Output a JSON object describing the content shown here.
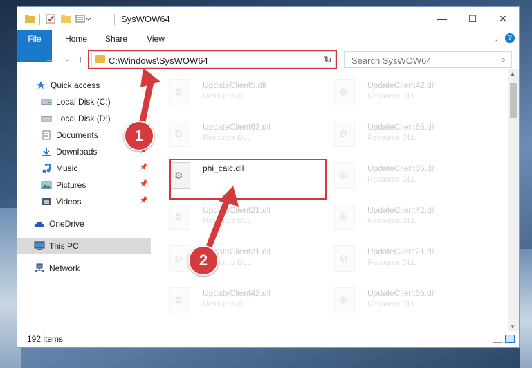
{
  "window": {
    "title": "SysWOW64",
    "controls": {
      "minimize": "—",
      "maximize": "☐",
      "close": "✕"
    }
  },
  "ribbon": {
    "tabs": [
      "File",
      "Home",
      "Share",
      "View"
    ]
  },
  "address": {
    "path": "C:\\Windows\\SysWOW64",
    "search_placeholder": "Search SysWOW64"
  },
  "nav": {
    "items": [
      {
        "label": "Quick access",
        "icon": "star-icon",
        "pinned": false,
        "indent": false
      },
      {
        "label": "Local Disk (C:)",
        "icon": "drive-icon",
        "pinned": false,
        "indent": true
      },
      {
        "label": "Local Disk (D:)",
        "icon": "drive-icon",
        "pinned": false,
        "indent": true
      },
      {
        "label": "Documents",
        "icon": "documents-icon",
        "pinned": true,
        "indent": true
      },
      {
        "label": "Downloads",
        "icon": "download-icon",
        "pinned": true,
        "indent": true
      },
      {
        "label": "Music",
        "icon": "music-icon",
        "pinned": true,
        "indent": true
      },
      {
        "label": "Pictures",
        "icon": "pictures-icon",
        "pinned": true,
        "indent": true
      },
      {
        "label": "Videos",
        "icon": "videos-icon",
        "pinned": true,
        "indent": true
      },
      {
        "label": "OneDrive",
        "icon": "cloud-icon",
        "pinned": false,
        "indent": false
      },
      {
        "label": "This PC",
        "icon": "computer-icon",
        "pinned": false,
        "indent": false,
        "selected": true
      },
      {
        "label": "Network",
        "icon": "network-icon",
        "pinned": false,
        "indent": false
      }
    ]
  },
  "files": {
    "left": [
      {
        "name": "UpdateClient5.dll",
        "type": "Resource DLL"
      },
      {
        "name": "UpdateClient63.dll",
        "type": "Resource DLL"
      },
      {
        "name": "phi_calc.dll",
        "type": "",
        "highlight": true
      },
      {
        "name": "UpdateClient21.dll",
        "type": "Resource DLL"
      },
      {
        "name": "UpdateClient21.dll",
        "type": "Resource DLL"
      },
      {
        "name": "UpdateClient42.dll",
        "type": "Resource DLL"
      }
    ],
    "right": [
      {
        "name": "UpdateClient42.dll",
        "type": "Resource DLL"
      },
      {
        "name": "UpdateClient65.dll",
        "type": "Resource DLL"
      },
      {
        "name": "UpdateClient65.dll",
        "type": "Resource DLL"
      },
      {
        "name": "UpdateClient42.dll",
        "type": "Resource DLL"
      },
      {
        "name": "UpdateClient21.dll",
        "type": "Resource DLL"
      },
      {
        "name": "UpdateClient65.dll",
        "type": "Resource DLL"
      }
    ]
  },
  "status": {
    "count": "192 items"
  },
  "callouts": [
    "1",
    "2"
  ],
  "colors": {
    "accent": "#1979ca",
    "highlight": "#d0383e",
    "badge": "#d53a3c"
  }
}
